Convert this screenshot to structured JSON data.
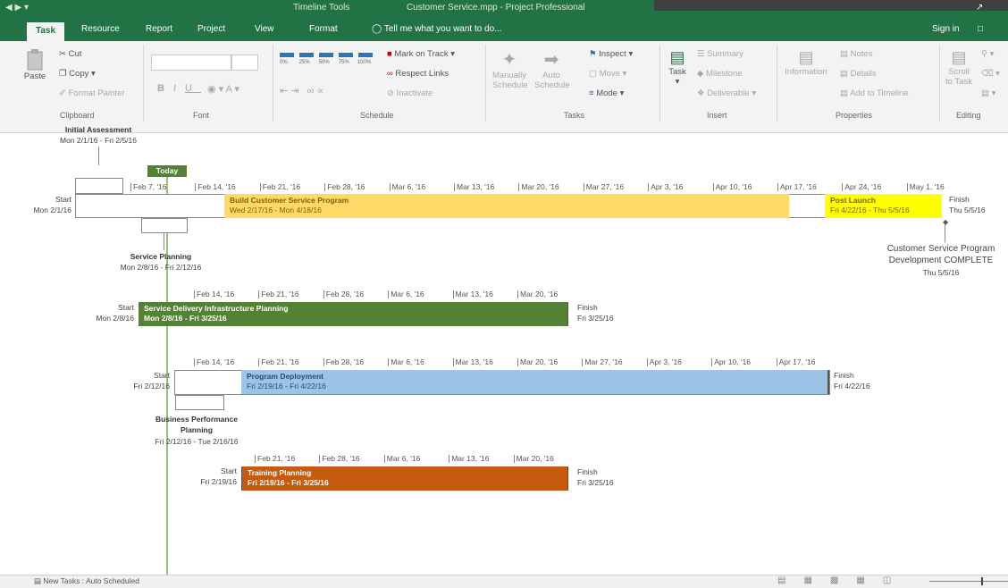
{
  "titlebar": {
    "context_tab": "Timeline Tools",
    "document_title": "Customer Service.mpp - Project Professional"
  },
  "tabs": [
    "Task",
    "Resource",
    "Report",
    "Project",
    "View",
    "Format"
  ],
  "tell_me": "Tell me what you want to do...",
  "sign_in": "Sign in",
  "ribbon": {
    "clipboard": {
      "label": "Clipboard",
      "paste": "Paste",
      "cut": "Cut",
      "copy": "Copy",
      "format_painter": "Format Painter"
    },
    "font": {
      "label": "Font"
    },
    "schedule": {
      "label": "Schedule",
      "pcts": [
        "0%",
        "25%",
        "50%",
        "75%",
        "100%"
      ],
      "mark_on_track": "Mark on Track",
      "respect_links": "Respect Links",
      "inactivate": "Inactivate"
    },
    "tasks": {
      "label": "Tasks",
      "manually": "Manually",
      "schedule1": "Schedule",
      "auto": "Auto",
      "schedule2": "Schedule",
      "inspect": "Inspect",
      "move": "Move",
      "mode": "Mode"
    },
    "insert": {
      "label": "Insert",
      "task": "Task",
      "summary": "Summary",
      "milestone": "Milestone",
      "deliverable": "Deliverable"
    },
    "properties": {
      "label": "Properties",
      "information": "Information",
      "notes": "Notes",
      "details": "Details",
      "add_to_timeline": "Add to Timeline"
    },
    "editing": {
      "label": "Editing",
      "scroll": "Scroll",
      "to_task": "to Task"
    }
  },
  "timeline": {
    "today": "Today",
    "initial_assessment": {
      "name": "Initial Assessment",
      "dates": "Mon 2/1/16 - Fri 2/5/16"
    },
    "row1": {
      "start_word": "Start",
      "start_date": "Mon 2/1/16",
      "finish_word": "Finish",
      "finish_date": "Thu 5/5/16",
      "ticks": [
        "Feb 7, '16",
        "Feb 14, '16",
        "Feb 21, '16",
        "Feb 28, '16",
        "Mar 6, '16",
        "Mar 13, '16",
        "Mar 20, '16",
        "Mar 27, '16",
        "Apr 3, '16",
        "Apr 10, '16",
        "Apr 17, '16",
        "Apr 24, '16",
        "May 1, '16"
      ],
      "build": {
        "name": "Build Customer Service Program",
        "dates": "Wed 2/17/16 - Mon 4/18/16",
        "color": "#ffd966"
      },
      "post_launch": {
        "name": "Post Launch",
        "dates": "Fri 4/22/16 - Thu 5/5/16",
        "color": "#ffff00"
      }
    },
    "milestone": {
      "line1": "Customer Service Program",
      "line2": "Development COMPLETE",
      "date": "Thu 5/5/16"
    },
    "service_planning": {
      "name": "Service Planning",
      "dates": "Mon 2/8/16 - Fri 2/12/16"
    },
    "row2": {
      "start_word": "Start",
      "start_date": "Mon 2/8/16",
      "finish_word": "Finish",
      "finish_date": "Fri 3/25/16",
      "ticks": [
        "Feb 14, '16",
        "Feb 21, '16",
        "Feb 28, '16",
        "Mar 6, '16",
        "Mar 13, '16",
        "Mar 20, '16"
      ],
      "bar": {
        "name": "Service Delivery Infrastructure Planning",
        "dates": "Mon 2/8/16 - Fri 3/25/16",
        "color": "#548235"
      }
    },
    "row3": {
      "start_word": "Start",
      "start_date": "Fri 2/12/16",
      "finish_word": "Finish",
      "finish_date": "Fri 4/22/16",
      "ticks": [
        "Feb 14, '16",
        "Feb 21, '16",
        "Feb 28, '16",
        "Mar 6, '16",
        "Mar 13, '16",
        "Mar 20, '16",
        "Mar 27, '16",
        "Apr 3, '16",
        "Apr 10, '16",
        "Apr 17, '16"
      ],
      "bar": {
        "name": "Program Deployment",
        "dates": "Fri 2/19/16 - Fri 4/22/16",
        "color": "#9dc3e6"
      }
    },
    "business_planning": {
      "line1": "Business Performance",
      "line2": "Planning",
      "dates": "Fri 2/12/16 - Tue 2/16/16"
    },
    "row4": {
      "start_word": "Start",
      "start_date": "Fri 2/19/16",
      "finish_word": "Finish",
      "finish_date": "Fri 3/25/16",
      "ticks": [
        "Feb 21, '16",
        "Feb 28, '16",
        "Mar 6, '16",
        "Mar 13, '16",
        "Mar 20, '16"
      ],
      "bar": {
        "name": "Training Planning",
        "dates": "Fri 2/19/16 - Fri 3/25/16",
        "color": "#c55a11"
      }
    }
  },
  "status": {
    "new_tasks": "New Tasks : Auto Scheduled"
  }
}
